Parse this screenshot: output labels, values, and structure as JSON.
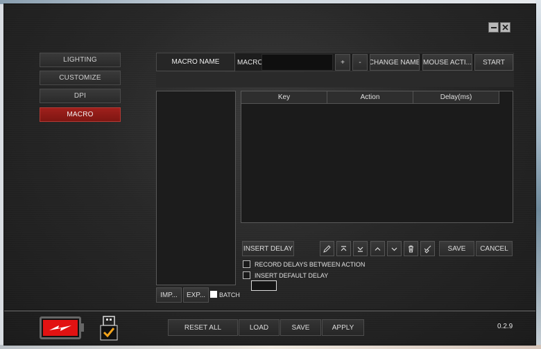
{
  "nav": {
    "items": [
      {
        "label": "LIGHTING"
      },
      {
        "label": "CUSTOMIZE"
      },
      {
        "label": "DPI"
      },
      {
        "label": "MACRO"
      }
    ],
    "active": "MACRO"
  },
  "window_controls": {
    "minimize": "minimize",
    "close": "close"
  },
  "header": {
    "macro_name_tab": "MACRO NAME",
    "macro_label": "MACRO",
    "macro_input_value": "",
    "add_label": "+",
    "remove_label": "-",
    "change_name_label": "CHANGE NAME",
    "mouse_action_label": "MOUSE ACTI...",
    "start_label": "START"
  },
  "table": {
    "columns": [
      "Key",
      "Action",
      "Delay(ms)"
    ],
    "rows": []
  },
  "editor": {
    "insert_delay_label": "INSERT DELAY",
    "save_label": "SAVE",
    "cancel_label": "CANCEL",
    "icons": [
      "pencil-icon",
      "move-top-icon",
      "move-bottom-icon",
      "move-up-icon",
      "move-down-icon",
      "trash-icon",
      "clear-icon"
    ]
  },
  "options": {
    "record_delays_label": "RECORD DELAYS BETWEEN ACTION",
    "record_delays_checked": false,
    "insert_default_delay_label": "INSERT DEFAULT DELAY",
    "insert_default_delay_checked": false,
    "default_delay_value": ""
  },
  "list_actions": {
    "import_label": "IMP...",
    "export_label": "EXP...",
    "batch_label": "BATCH",
    "batch_checked": false
  },
  "footer": {
    "reset_all_label": "RESET ALL",
    "load_label": "LOAD",
    "save_label": "SAVE",
    "apply_label": "APPLY",
    "version": "0.2.9"
  },
  "colors": {
    "accent": "#a0201c",
    "battery": "#e21212",
    "usb_check": "#f2a31b"
  }
}
